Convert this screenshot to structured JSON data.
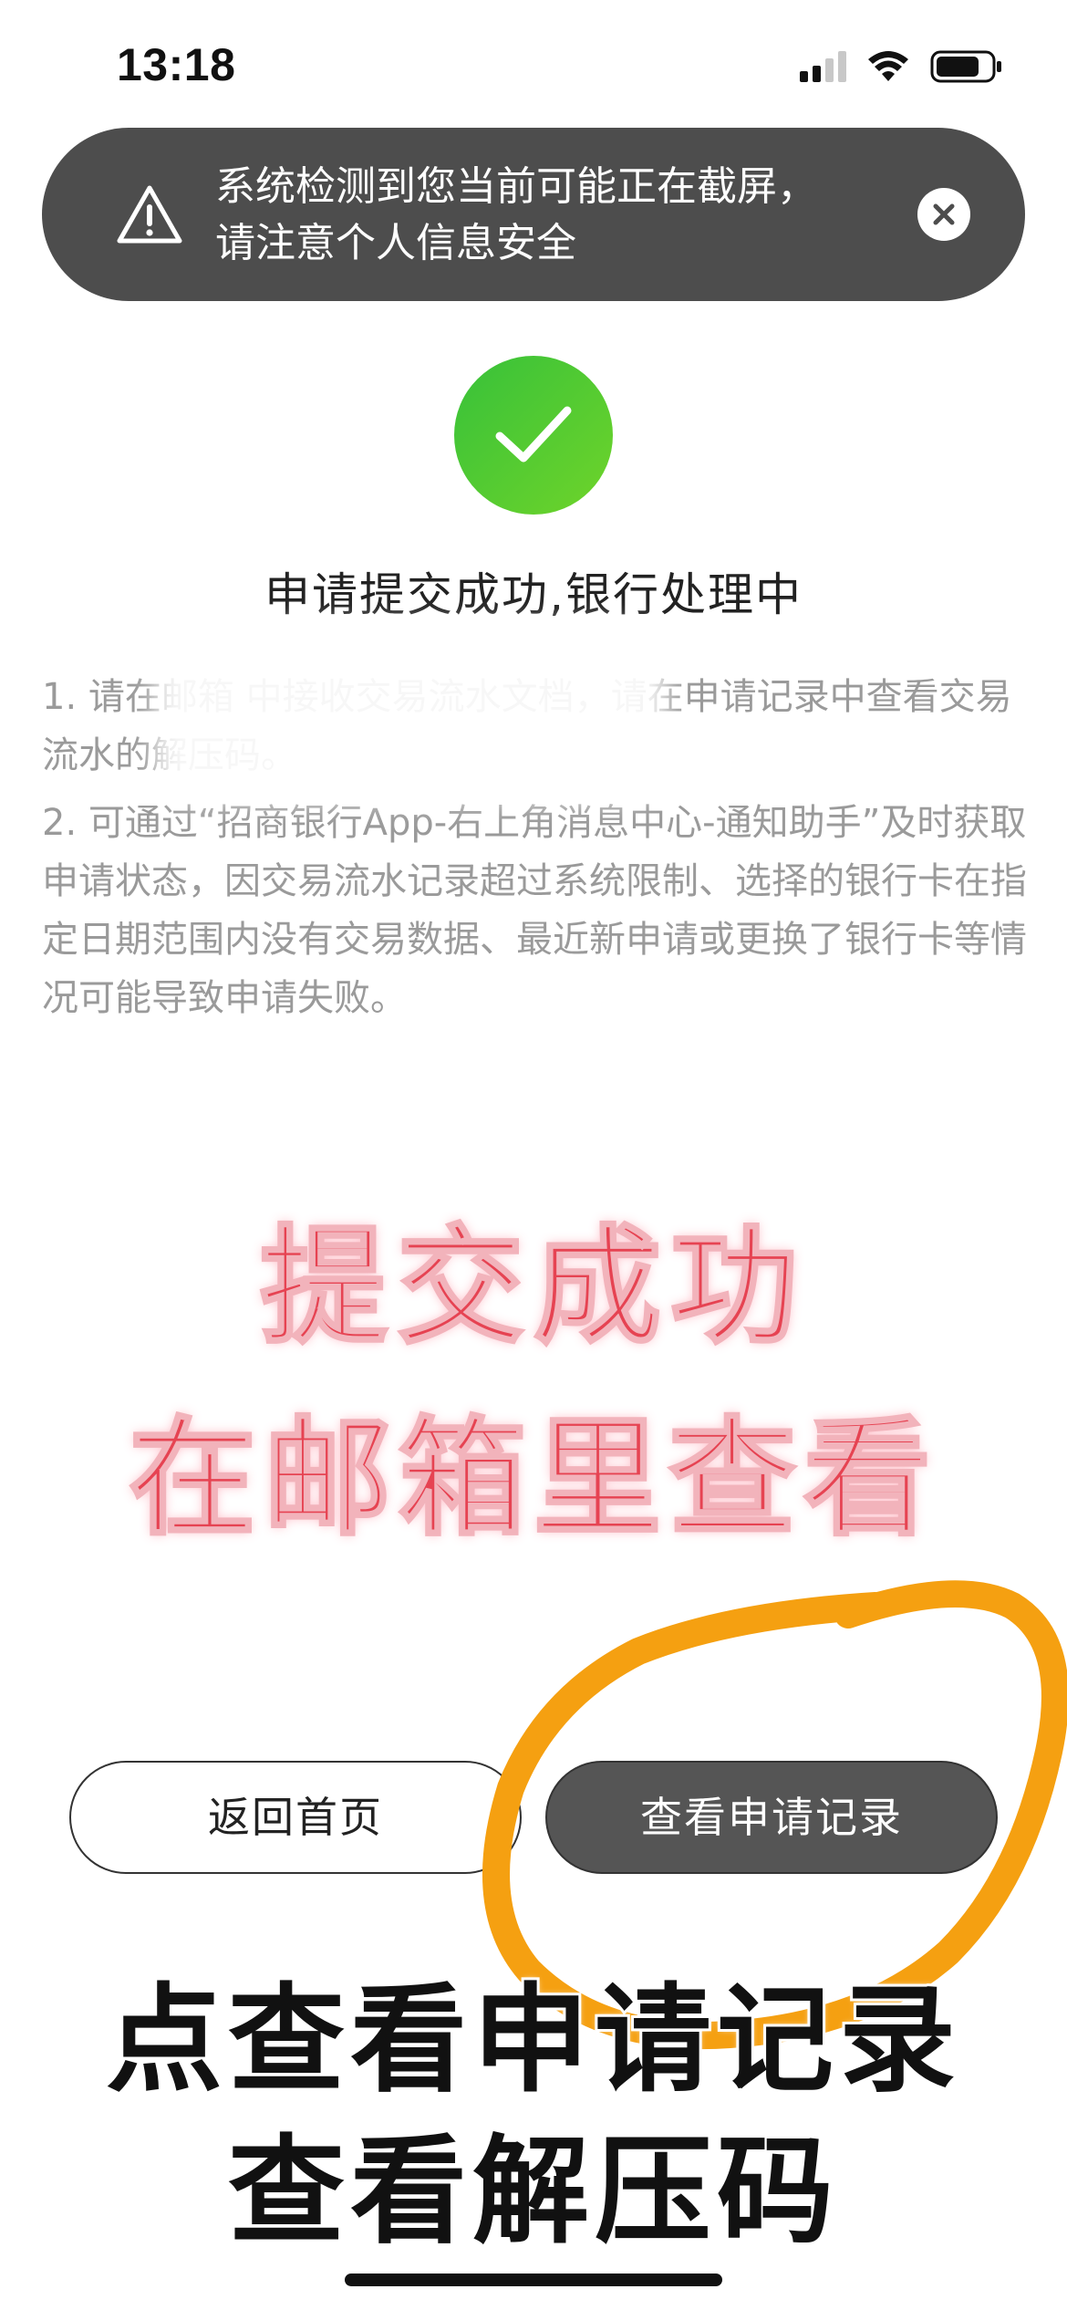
{
  "status_bar": {
    "time": "13:18"
  },
  "toast": {
    "line1": "系统检测到您当前可能正在截屏，",
    "line2": "请注意个人信息安全",
    "icon": "warning-triangle-icon",
    "close_icon": "close-icon"
  },
  "result": {
    "icon": "check-icon",
    "title": "申请提交成功,银行处理中"
  },
  "notes": {
    "item1": "1. 请在邮箱                                 中接收交易流水文档，请在申请记录中查看交易流水的解压码。",
    "item2": "2. 可通过“招商银行App-右上角消息中心-通知助手”及时获取申请状态，因交易流水记录超过系统限制、选择的银行卡在指定日期范围内没有交易数据、最近新申请或更换了银行卡等情况可能导致申请失败。"
  },
  "overlay": {
    "caption1": "提交成功",
    "caption2": "在邮箱里查看",
    "caption3": "点查看申请记录",
    "caption4": "查看解压码"
  },
  "buttons": {
    "home": "返回首页",
    "records": "查看申请记录"
  },
  "colors": {
    "toast_bg": "#4d4d4d",
    "success_green": "#37c13a",
    "caption_red": "#e64352",
    "annotation_orange": "#f5a011",
    "primary_button": "#555555"
  }
}
